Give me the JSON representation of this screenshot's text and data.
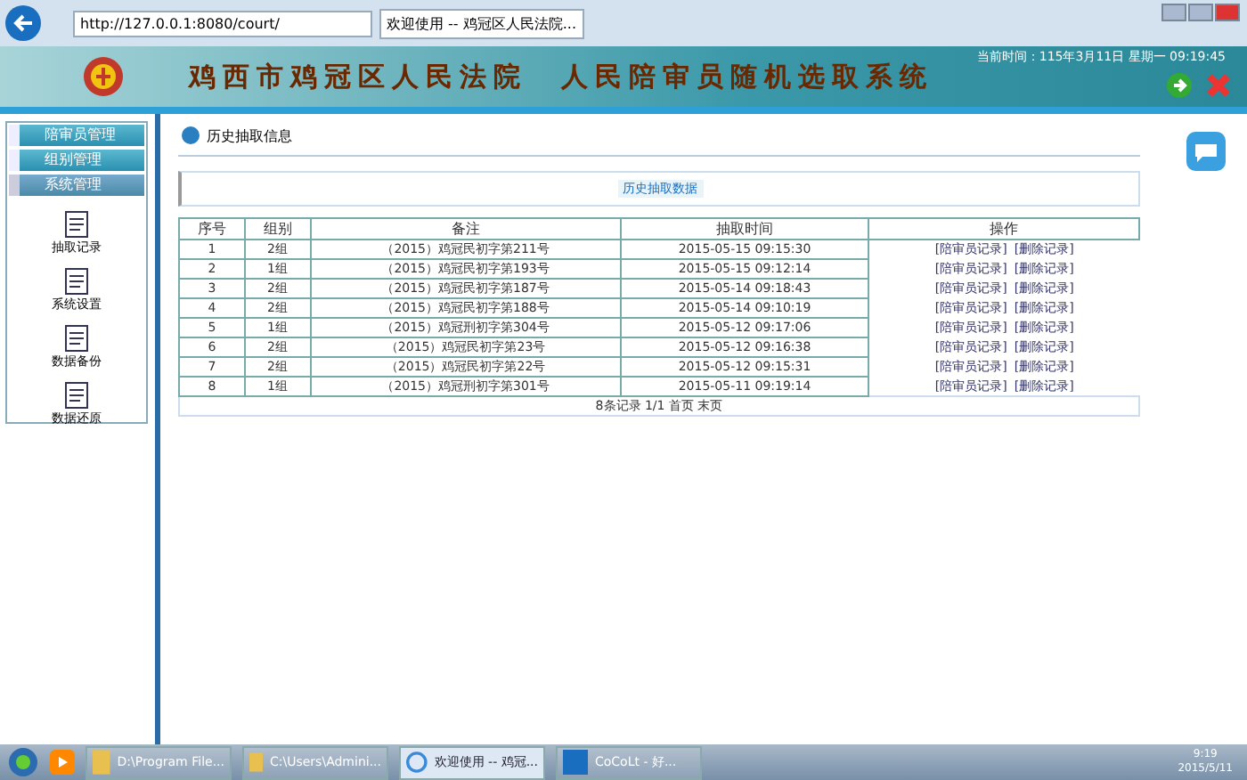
{
  "browser": {
    "url": "http://127.0.0.1:8080/court/",
    "tab_title": "欢迎使用 -- 鸡冠区人民法院..."
  },
  "header": {
    "title": "鸡西市鸡冠区人民法院　人民陪审员随机选取系统",
    "time": "当前时间：115年3月11日 星期一 09:19:45"
  },
  "sidebar": {
    "sections": [
      {
        "label": "陪审员管理",
        "expanded": false
      },
      {
        "label": "组别管理",
        "expanded": false
      },
      {
        "label": "系统管理",
        "expanded": true
      }
    ],
    "tools": [
      "抽取记录",
      "系统设置",
      "数据备份",
      "数据还原"
    ]
  },
  "panel": {
    "title": "历史抽取信息",
    "subtitle": "历史抽取数据",
    "columns": [
      "序号",
      "组别",
      "备注",
      "抽取时间",
      "操作"
    ],
    "rows": [
      {
        "no": "1",
        "group": "2组",
        "remark": "（2015）鸡冠民初字第211号",
        "time": "2015-05-15 09:15:30",
        "actions": [
          "[陪审员记录]",
          "[删除记录]"
        ]
      },
      {
        "no": "2",
        "group": "1组",
        "remark": "（2015）鸡冠民初字第193号",
        "time": "2015-05-15 09:12:14",
        "actions": [
          "[陪审员记录]",
          "[删除记录]"
        ]
      },
      {
        "no": "3",
        "group": "2组",
        "remark": "（2015）鸡冠民初字第187号",
        "time": "2015-05-14 09:18:43",
        "actions": [
          "[陪审员记录]",
          "[删除记录]"
        ]
      },
      {
        "no": "4",
        "group": "2组",
        "remark": "（2015）鸡冠民初字第188号",
        "time": "2015-05-14 09:10:19",
        "actions": [
          "[陪审员记录]",
          "[删除记录]"
        ]
      },
      {
        "no": "5",
        "group": "1组",
        "remark": "（2015）鸡冠刑初字第304号",
        "time": "2015-05-12 09:17:06",
        "actions": [
          "[陪审员记录]",
          "[删除记录]"
        ]
      },
      {
        "no": "6",
        "group": "2组",
        "remark": "（2015）鸡冠民初字第23号",
        "time": "2015-05-12 09:16:38",
        "actions": [
          "[陪审员记录]",
          "[删除记录]"
        ]
      },
      {
        "no": "7",
        "group": "2组",
        "remark": "（2015）鸡冠民初字第22号",
        "time": "2015-05-12 09:15:31",
        "actions": [
          "[陪审员记录]",
          "[删除记录]"
        ]
      },
      {
        "no": "8",
        "group": "1组",
        "remark": "（2015）鸡冠刑初字第301号",
        "time": "2015-05-11 09:19:14",
        "actions": [
          "[陪审员记录]",
          "[删除记录]"
        ]
      }
    ],
    "pager": "8条记录 1/1 首页 末页"
  },
  "taskbar": {
    "items": [
      {
        "label": "D:\\Program File...",
        "kind": "folder",
        "active": false
      },
      {
        "label": "C:\\Users\\Admini...",
        "kind": "folder",
        "active": false
      },
      {
        "label": "欢迎使用 -- 鸡冠...",
        "kind": "browser",
        "active": true
      },
      {
        "label": "CoCoLt - 好...",
        "kind": "app",
        "active": false
      }
    ],
    "time": "9:19",
    "date": "2015/5/11"
  }
}
